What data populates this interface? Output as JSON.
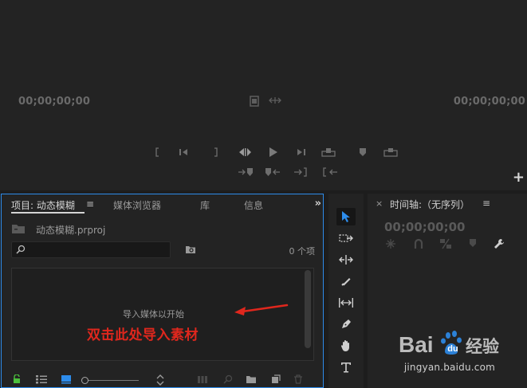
{
  "program_monitor": {
    "timecode_left": "00;00;00;00",
    "timecode_right": "00;00;00;00"
  },
  "project_panel": {
    "tabs": [
      {
        "label": "项目: 动态模糊"
      },
      {
        "label": "媒体浏览器"
      },
      {
        "label": "库"
      },
      {
        "label": "信息"
      }
    ],
    "menu_glyph": "≡",
    "overflow_glyph": "»",
    "project_file": "动态模糊.prproj",
    "search_placeholder": "",
    "item_count": "0 个项",
    "drop_hint": "导入媒体以开始",
    "annotation": "双击此处导入素材"
  },
  "timeline_panel": {
    "close_glyph": "×",
    "title": "时间轴:（无序列）",
    "menu_glyph": "≡",
    "timecode": "00;00;00;00"
  },
  "watermark": {
    "url": "jingyan.baidu.com"
  },
  "colors": {
    "accent": "#2d8ceb",
    "annotation": "#e0271d",
    "panel_bg": "#232323"
  }
}
